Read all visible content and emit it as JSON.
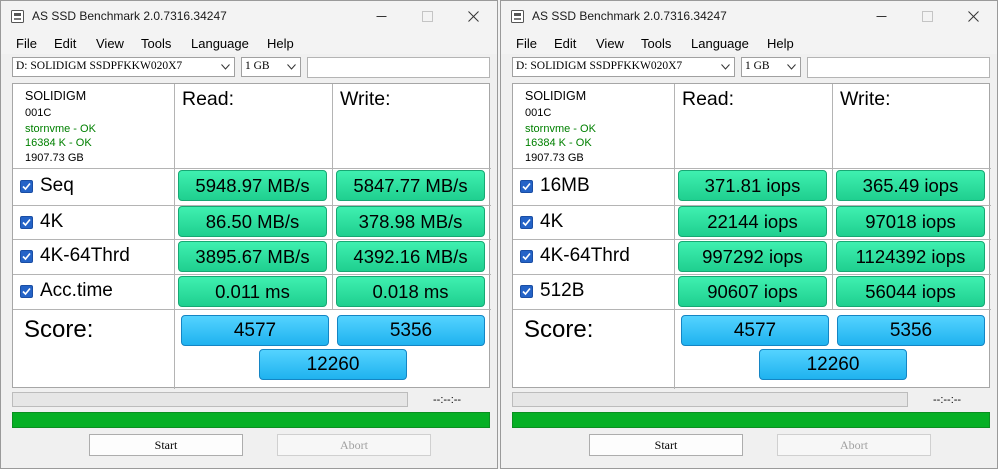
{
  "windows": [
    {
      "title": "AS SSD Benchmark 2.0.7316.34247",
      "menu": [
        "File",
        "Edit",
        "View",
        "Tools",
        "Language",
        "Help"
      ],
      "drive": "D: SOLIDIGM SSDPFKKW020X7",
      "test_size": "1 GB",
      "info": {
        "model": "SOLIDIGM",
        "firmware": "001C",
        "driver": "stornvme - OK",
        "alignment": "16384 K - OK",
        "capacity": "1907.73 GB"
      },
      "read_header": "Read:",
      "write_header": "Write:",
      "rows": [
        {
          "label": "Seq",
          "checked": true,
          "read": "5948.97 MB/s",
          "write": "5847.77 MB/s"
        },
        {
          "label": "4K",
          "checked": true,
          "read": "86.50 MB/s",
          "write": "378.98 MB/s"
        },
        {
          "label": "4K-64Thrd",
          "checked": true,
          "read": "3895.67 MB/s",
          "write": "4392.16 MB/s"
        },
        {
          "label": "Acc.time",
          "checked": true,
          "read": "0.011 ms",
          "write": "0.018 ms"
        }
      ],
      "score_label": "Score:",
      "score": {
        "read": "4577",
        "write": "5356",
        "total": "12260"
      },
      "elapsed": "--:--:--",
      "progress": 1.0,
      "start_label": "Start",
      "abort_label": "Abort"
    },
    {
      "title": "AS SSD Benchmark 2.0.7316.34247",
      "menu": [
        "File",
        "Edit",
        "View",
        "Tools",
        "Language",
        "Help"
      ],
      "drive": "D: SOLIDIGM SSDPFKKW020X7",
      "test_size": "1 GB",
      "info": {
        "model": "SOLIDIGM",
        "firmware": "001C",
        "driver": "stornvme - OK",
        "alignment": "16384 K - OK",
        "capacity": "1907.73 GB"
      },
      "read_header": "Read:",
      "write_header": "Write:",
      "rows": [
        {
          "label": "16MB",
          "checked": true,
          "read": "371.81 iops",
          "write": "365.49 iops"
        },
        {
          "label": "4K",
          "checked": true,
          "read": "22144 iops",
          "write": "97018 iops"
        },
        {
          "label": "4K-64Thrd",
          "checked": true,
          "read": "997292 iops",
          "write": "1124392 iops"
        },
        {
          "label": "512B",
          "checked": true,
          "read": "90607 iops",
          "write": "56044 iops"
        }
      ],
      "score_label": "Score:",
      "score": {
        "read": "4577",
        "write": "5356",
        "total": "12260"
      },
      "elapsed": "--:--:--",
      "progress": 1.0,
      "start_label": "Start",
      "abort_label": "Abort"
    }
  ],
  "colors": {
    "result_green": "#2ee0a0",
    "score_blue": "#38c3f7",
    "progress_green": "#06b025",
    "status_ok": "#008000"
  },
  "icons": {
    "app": "as-ssd-app-icon",
    "minimize": "minimize-icon",
    "maximize": "maximize-icon",
    "close": "close-icon",
    "dropdown": "chevron-down-icon",
    "checkbox": "checkmark-icon"
  }
}
